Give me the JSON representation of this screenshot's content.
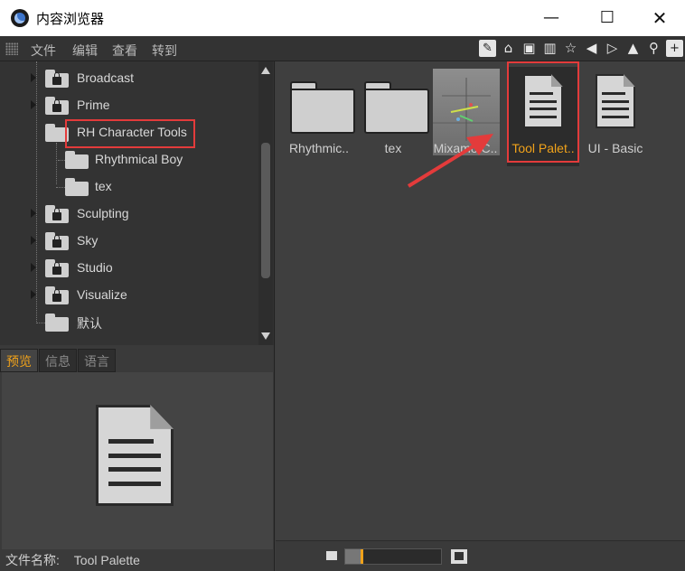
{
  "window": {
    "title": "内容浏览器",
    "minimize": "—",
    "maximize": "☐",
    "close": "✕"
  },
  "menu": [
    "文件",
    "编辑",
    "查看",
    "转到"
  ],
  "toolbar_icons": [
    "pencil-icon",
    "home-icon",
    "bucket-icon",
    "book-icon",
    "star-icon",
    "back-icon",
    "forward-icon",
    "up-icon",
    "search-icon",
    "plus-icon"
  ],
  "tree": [
    {
      "label": "Broadcast",
      "locked": true
    },
    {
      "label": "Prime",
      "locked": true
    },
    {
      "label": "RH Character Tools",
      "locked": false,
      "expanded": true,
      "highlighted": true
    },
    {
      "label": "Rhythmical Boy",
      "locked": false,
      "child": true
    },
    {
      "label": "tex",
      "locked": false,
      "child": true
    },
    {
      "label": "Sculpting",
      "locked": true
    },
    {
      "label": "Sky",
      "locked": true
    },
    {
      "label": "Studio",
      "locked": true
    },
    {
      "label": "Visualize",
      "locked": true
    },
    {
      "label": "默认",
      "locked": false
    }
  ],
  "preview_tabs": [
    "预览",
    "信息",
    "语言"
  ],
  "preview": {
    "filename_label": "文件名称:",
    "filename": "Tool Palette"
  },
  "items": [
    {
      "caption": "Rhythmic..",
      "kind": "folder"
    },
    {
      "caption": "tex",
      "kind": "folder"
    },
    {
      "caption": "Mixamo C..",
      "kind": "thumbnail"
    },
    {
      "caption": "Tool Palet..",
      "kind": "document",
      "selected": true
    },
    {
      "caption": "UI - Basic",
      "kind": "document"
    }
  ],
  "colors": {
    "accent": "#f0a21a",
    "highlight": "#e33b3b",
    "panel": "#333333"
  },
  "zoom": {
    "level": 0.16
  }
}
